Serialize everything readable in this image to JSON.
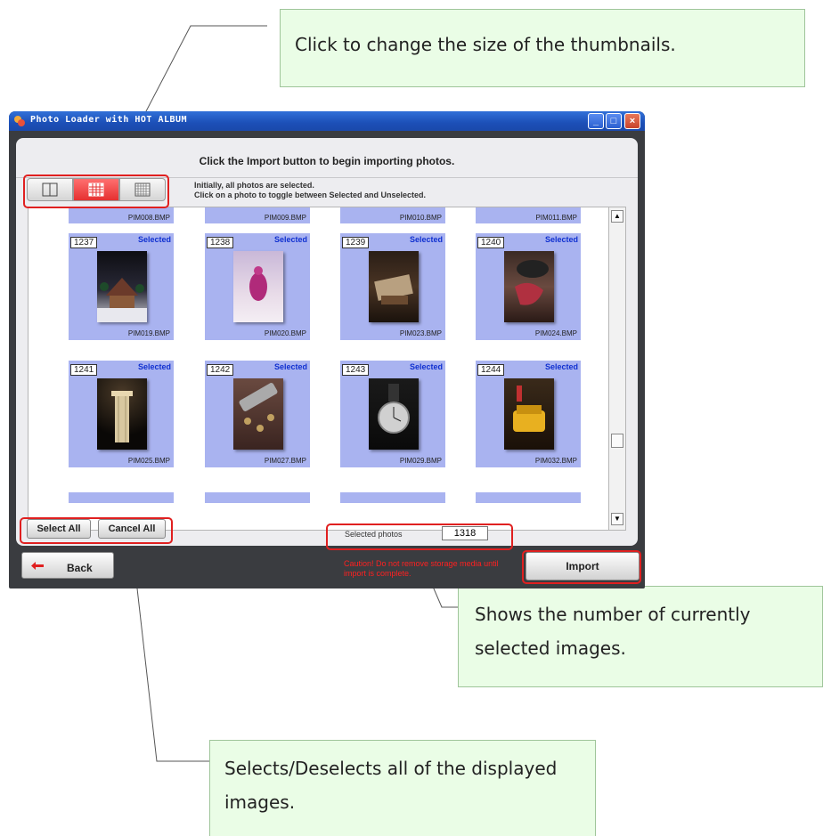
{
  "callouts": {
    "top": "Click to change the size of the thumbnails.",
    "middle": "Shows the number of currently selected images.",
    "bottom": "Selects/Deselects all of the displayed images."
  },
  "window": {
    "title": "Photo Loader with HOT ALBUM",
    "instruction": "Click the Import button to begin importing photos.",
    "hint_line1": "Initially, all photos are selected.",
    "hint_line2": "Click on a photo to toggle between Selected and Unselected.",
    "view_buttons": [
      "large-thumbnails-icon",
      "medium-thumbnails-icon",
      "small-thumbnails-icon"
    ]
  },
  "grid": {
    "top_row_files": [
      "PIM008.BMP",
      "PIM009.BMP",
      "PIM010.BMP",
      "PIM011.BMP"
    ],
    "rows": [
      [
        {
          "num": "1237",
          "status": "Selected",
          "file": "PIM019.BMP"
        },
        {
          "num": "1238",
          "status": "Selected",
          "file": "PIM020.BMP"
        },
        {
          "num": "1239",
          "status": "Selected",
          "file": "PIM023.BMP"
        },
        {
          "num": "1240",
          "status": "Selected",
          "file": "PIM024.BMP"
        }
      ],
      [
        {
          "num": "1241",
          "status": "Selected",
          "file": "PIM025.BMP"
        },
        {
          "num": "1242",
          "status": "Selected",
          "file": "PIM027.BMP"
        },
        {
          "num": "1243",
          "status": "Selected",
          "file": "PIM029.BMP"
        },
        {
          "num": "1244",
          "status": "Selected",
          "file": "PIM032.BMP"
        }
      ]
    ]
  },
  "footer": {
    "select_all": "Select All",
    "cancel_all": "Cancel All",
    "selected_label": "Selected photos",
    "selected_count": "1318",
    "back": "Back",
    "warning": "Caution! Do not remove storage media until import is complete.",
    "import": "Import"
  },
  "colors": {
    "highlight": "#e02020",
    "cell_selected": "#a9b3f0",
    "callout_bg": "#eafde6"
  }
}
